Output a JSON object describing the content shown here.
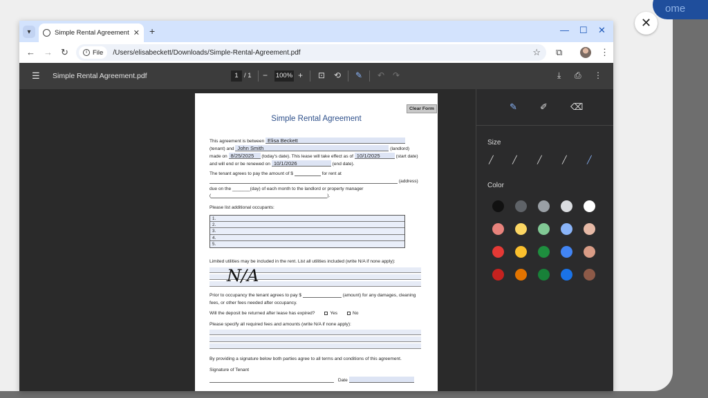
{
  "overlay": {
    "top_button_label": "ome",
    "close_glyph": "✕"
  },
  "browser": {
    "tab": {
      "title": "Simple Rental Agreement",
      "close_glyph": "✕"
    },
    "new_tab_glyph": "+",
    "window_controls": [
      "—",
      "☐",
      "✕"
    ],
    "address": {
      "chip_label": "File",
      "url": "/Users/elisabeckett/Downloads/Simple-Rental-Agreement.pdf"
    }
  },
  "pdf_toolbar": {
    "file_name": "Simple Rental Agreement.pdf",
    "page_current": "1",
    "page_total": "/ 1",
    "zoom": "100%"
  },
  "document": {
    "clear_form_label": "Clear Form",
    "title": "Simple Rental Agreement",
    "line1_prefix": "This agreement is between",
    "tenant_name": "Elisa Beckett",
    "line2_prefix": "(tenant) and",
    "landlord_name": "John Smith",
    "line2_suffix": "(landlord)",
    "line3_prefix": "made on",
    "made_on_date": "8/25/2025",
    "line3_mid": "(today's date). This lease will take effect as of",
    "start_date": "10/1/2025",
    "line3_suffix": "(start date)",
    "line4_prefix": "and will end or be renewed on",
    "end_date": "10/1/2026",
    "line4_suffix": "(end date).",
    "rent_line": "The tenant agrees to pay the amount of $",
    "rent_line_suffix": "for rent at",
    "address_suffix": "(address)",
    "due_line": "due on the _______(day) of each month to the landlord or property manager",
    "paren_line_open": "(",
    "paren_line_close": ").",
    "occupants_label": "Please list additional occupants:",
    "occupants": [
      "1.",
      "2.",
      "3.",
      "4.",
      "5."
    ],
    "utilities_label": "Limited utilities may be included in the rent. List all utilities included (write N/A if none apply):",
    "utilities_value": "N/A",
    "deposit_line1": "Prior to occupancy the tenant agrees to pay $",
    "deposit_line1_suffix": "(amount) for any damages, cleaning",
    "deposit_line2": "fees, or other fees needed after occupancy.",
    "deposit_question": "Will the deposit be returned after lease has expired?",
    "yes_label": "Yes",
    "no_label": "No",
    "fees_label": "Please specify all required fees and amounts (write N/A if none apply):",
    "agreement_line": "By providing a signature below both parties agree to all terms and conditions of this agreement.",
    "signature_label": "Signature of Tenant",
    "date_label": "Date"
  },
  "annotation_panel": {
    "size_label": "Size",
    "color_label": "Color",
    "colors": [
      [
        "#111111",
        "#5f6368",
        "#9aa0a6",
        "#dadce0",
        "#ffffff"
      ],
      [
        "#e8837c",
        "#fcd663",
        "#81c995",
        "#8ab4f8",
        "#e6b9a6"
      ],
      [
        "#e53935",
        "#fbc02d",
        "#1e8e3e",
        "#4285f4",
        "#d99c86"
      ],
      [
        "#c5221f",
        "#e37400",
        "#188038",
        "#1a73e8",
        "#8d5a48"
      ]
    ]
  }
}
